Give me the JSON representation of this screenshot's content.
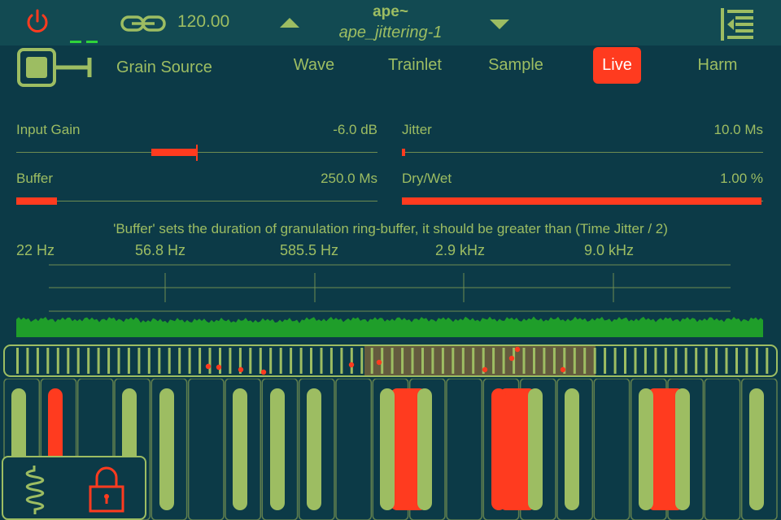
{
  "header": {
    "bpm": "120.00",
    "title": "ape~",
    "preset": "ape_jittering-1",
    "icons": [
      "power-icon",
      "link-icon",
      "arrow-up-icon",
      "arrow-down-icon",
      "menu-icon"
    ]
  },
  "source": {
    "label": "Grain Source",
    "tabs": [
      {
        "label": "Wave",
        "active": false
      },
      {
        "label": "Trainlet",
        "active": false
      },
      {
        "label": "Sample",
        "active": false
      },
      {
        "label": "Live",
        "active": true
      },
      {
        "label": "Harm",
        "active": false
      }
    ]
  },
  "params": {
    "input_gain": {
      "label": "Input Gain",
      "value": "-6.0 dB"
    },
    "jitter": {
      "label": "Jitter",
      "value": "10.0 Ms"
    },
    "buffer": {
      "label": "Buffer",
      "value": "250.0 Ms"
    },
    "dry_wet": {
      "label": "Dry/Wet",
      "value": "1.00 %"
    }
  },
  "hint": "'Buffer' sets the duration of granulation ring-buffer,  it should be greater than (Time Jitter / 2)",
  "frequencies": [
    "22 Hz",
    "56.8 Hz",
    "585.5 Hz",
    "2.9 kHz",
    "9.0 kHz"
  ],
  "colors": {
    "background": "#0c3a47",
    "header": "#124a52",
    "accent": "#ff3b1f",
    "green": "#9dbd62",
    "waveform": "#1f9e2a"
  }
}
